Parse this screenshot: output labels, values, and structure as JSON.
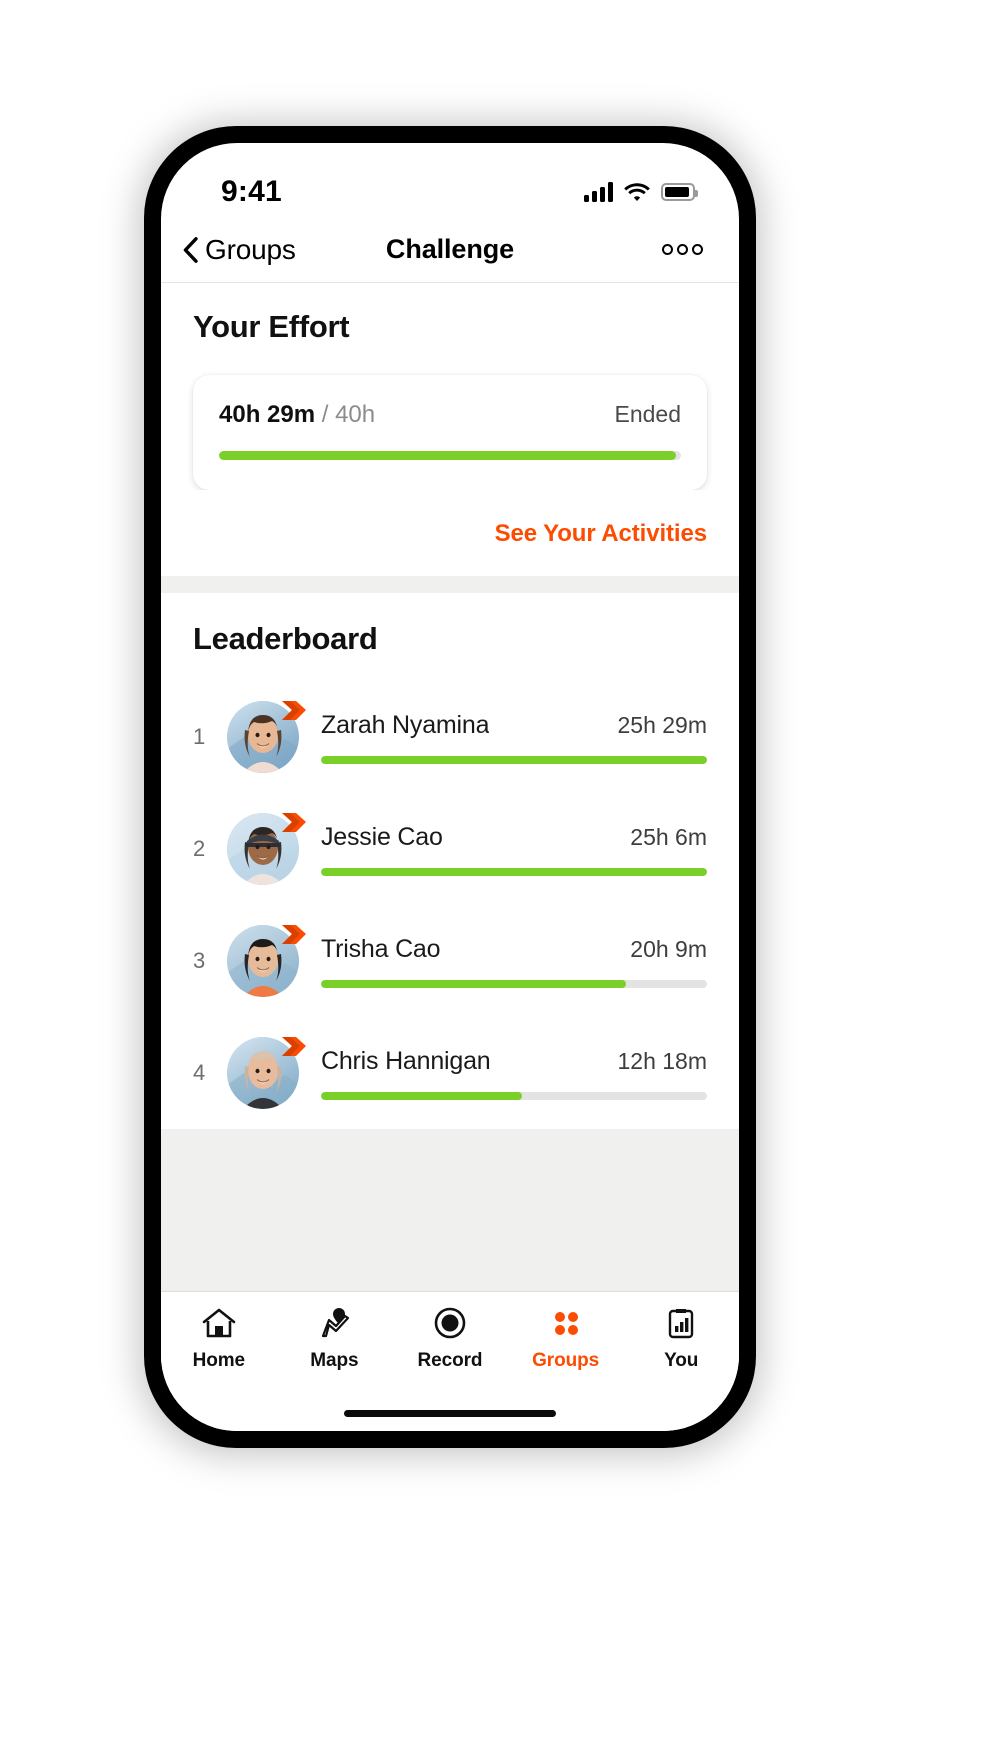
{
  "status_bar": {
    "time": "9:41",
    "cellular_icon": "signal-bars-icon",
    "wifi_icon": "wifi-icon",
    "battery_icon": "battery-icon"
  },
  "nav_bar": {
    "back_icon": "chevron-left-icon",
    "back_label": "Groups",
    "title": "Challenge",
    "more_icon": "more-options-icon"
  },
  "effort": {
    "section_title": "Your Effort",
    "elapsed": "40h 29m",
    "separator": "/",
    "goal": "40h",
    "status": "Ended",
    "progress_percent": 99,
    "see_activities_label": "See Your Activities"
  },
  "leaderboard": {
    "title": "Leaderboard",
    "rows": [
      {
        "rank": "1",
        "name": "Zarah Nyamina",
        "time": "25h 29m",
        "progress_percent": 100,
        "avatar": "avatar-zarah"
      },
      {
        "rank": "2",
        "name": "Jessie Cao",
        "time": "25h 6m",
        "progress_percent": 100,
        "avatar": "avatar-jessie"
      },
      {
        "rank": "3",
        "name": "Trisha Cao",
        "time": "20h 9m",
        "progress_percent": 79,
        "avatar": "avatar-trisha"
      },
      {
        "rank": "4",
        "name": "Chris Hannigan",
        "time": "12h 18m",
        "progress_percent": 52,
        "avatar": "avatar-chris"
      }
    ]
  },
  "tab_bar": {
    "items": [
      {
        "label": "Home",
        "icon": "home-icon",
        "active": false
      },
      {
        "label": "Maps",
        "icon": "map-pin-icon",
        "active": false
      },
      {
        "label": "Record",
        "icon": "record-icon",
        "active": false
      },
      {
        "label": "Groups",
        "icon": "groups-dots-icon",
        "active": true
      },
      {
        "label": "You",
        "icon": "profile-stats-icon",
        "active": false
      }
    ]
  },
  "colors": {
    "accent_orange": "#FC4C02",
    "progress_green": "#7AD029",
    "track_gray": "#E3E3E3",
    "divider_gray": "#F0F0EF"
  }
}
